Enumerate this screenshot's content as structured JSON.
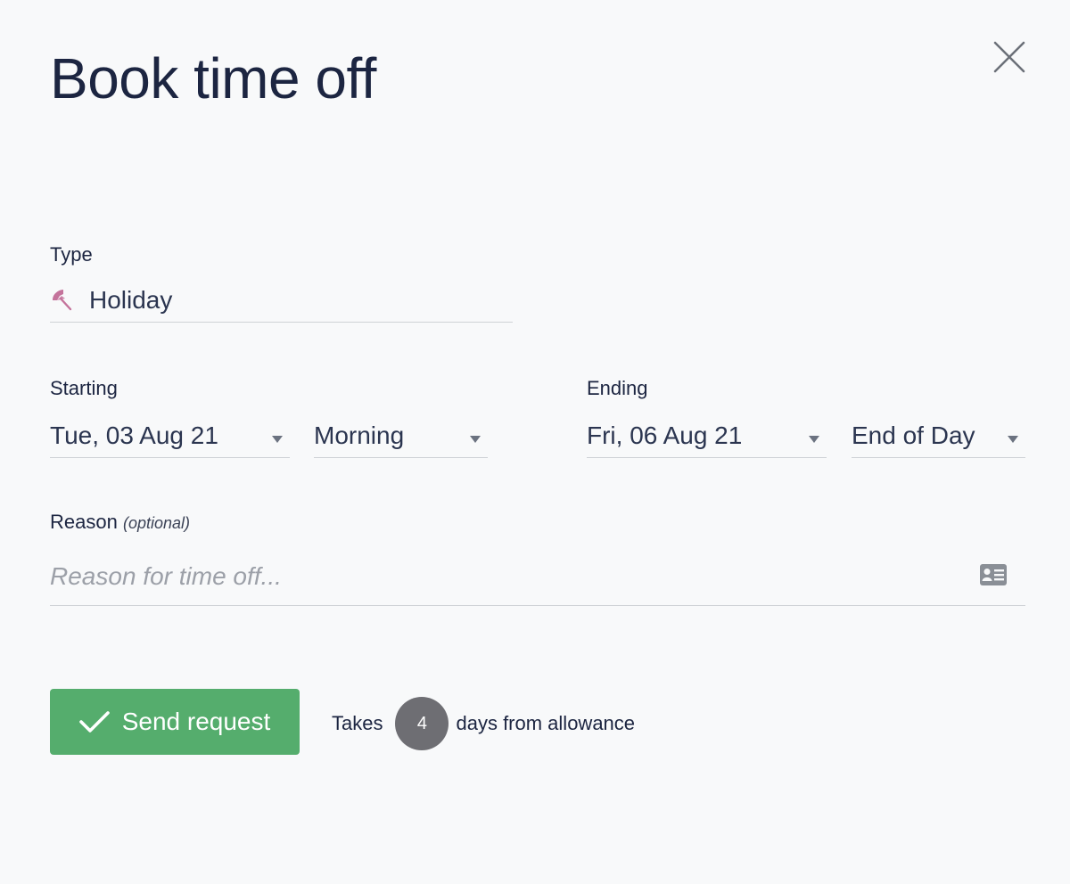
{
  "dialog": {
    "title": "Book time off",
    "close_icon": "close-icon"
  },
  "type": {
    "label": "Type",
    "value": "Holiday",
    "icon": "umbrella-icon",
    "icon_color": "#c4739b"
  },
  "starting": {
    "label": "Starting",
    "date": "Tue, 03 Aug 21",
    "period": "Morning"
  },
  "ending": {
    "label": "Ending",
    "date": "Fri, 06 Aug 21",
    "period": "End of Day"
  },
  "reason": {
    "label": "Reason",
    "optional_hint": "(optional)",
    "value": "",
    "placeholder": "Reason for time off...",
    "icon": "contact-card-icon"
  },
  "actions": {
    "send_label": "Send request",
    "send_icon": "checkmark-icon",
    "accent_color": "#55ad6d"
  },
  "summary": {
    "prefix": "Takes",
    "days": "4",
    "suffix": "days from allowance"
  }
}
